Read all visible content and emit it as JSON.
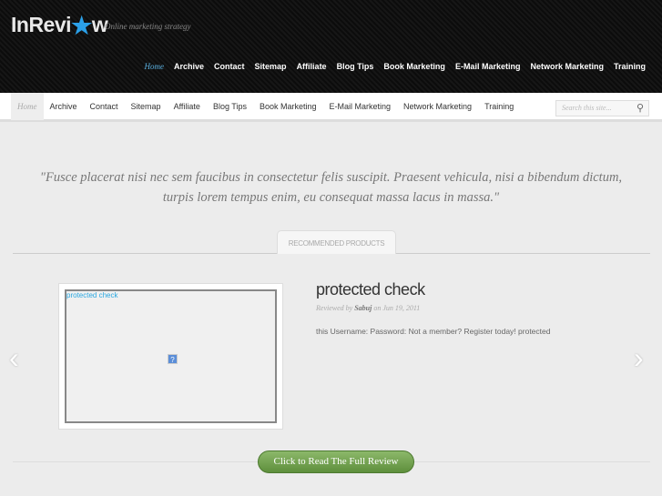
{
  "header": {
    "logo": "InRevi",
    "logo_tail": "w",
    "tagline": "Online marketing strategy",
    "nav": [
      "Home",
      "Archive",
      "Contact",
      "Sitemap",
      "Affiliate",
      "Blog Tips",
      "Book Marketing",
      "E-Mail Marketing",
      "Network Marketing",
      "Training"
    ]
  },
  "subnav": {
    "items": [
      "Home",
      "Archive",
      "Contact",
      "Sitemap",
      "Affiliate",
      "Blog Tips",
      "Book Marketing",
      "E-Mail Marketing",
      "Network Marketing",
      "Training"
    ],
    "search_placeholder": "Search this site..."
  },
  "quote": "\"Fusce placerat nisi nec sem faucibus in consectetur felis suscipit. Praesent vehicula, nisi a bibendum dictum, turpis lorem tempus enim, eu consequat massa lacus in massa.\"",
  "section_tab": "RECOMMENDED PRODUCTS",
  "product": {
    "image_alt": "protected check",
    "title": "protected check",
    "reviewed_by": "Reviewed by",
    "author": "Sabuj",
    "on": "on Jun 19, 2011",
    "excerpt": "this Username: Password: Not a member? Register today! protected",
    "button": "Click to Read The Full Review"
  },
  "colors": {
    "accent": "#2ba0e8",
    "button": "#6f9e4c"
  }
}
